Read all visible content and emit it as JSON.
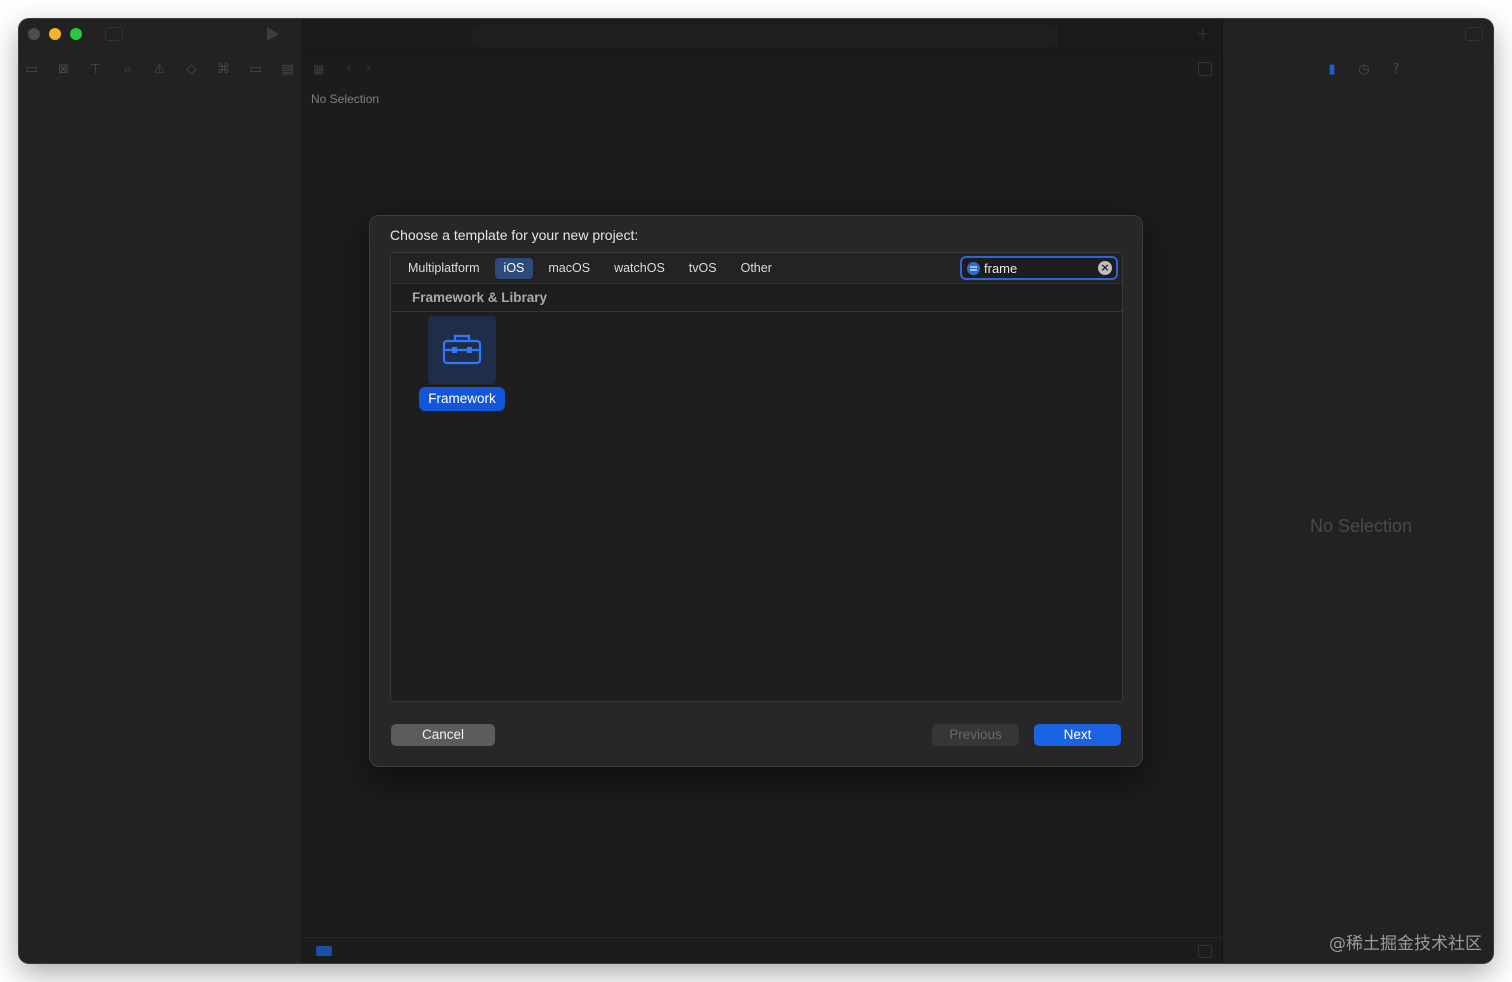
{
  "navigator": {
    "icons": [
      "folder-icon",
      "source-control-icon",
      "symbol-icon",
      "search-icon",
      "warning-icon",
      "test-diamond-icon",
      "debug-icon",
      "breakpoint-icon",
      "report-icon"
    ],
    "icon_glyphs": [
      "▭",
      "⊠",
      "⊤",
      "⌕",
      "⚠",
      "◇",
      "⌘",
      "▭",
      "▤"
    ]
  },
  "editor": {
    "no_selection": "No Selection"
  },
  "inspector": {
    "no_selection": "No Selection"
  },
  "dialog": {
    "title": "Choose a template for your new project:",
    "tabs": [
      {
        "label": "Multiplatform",
        "active": false
      },
      {
        "label": "iOS",
        "active": true
      },
      {
        "label": "macOS",
        "active": false
      },
      {
        "label": "watchOS",
        "active": false
      },
      {
        "label": "tvOS",
        "active": false
      },
      {
        "label": "Other",
        "active": false
      }
    ],
    "search": {
      "value": "frame"
    },
    "section_title": "Framework & Library",
    "template": {
      "label": "Framework",
      "icon": "toolbox-icon"
    },
    "buttons": {
      "cancel": "Cancel",
      "previous": "Previous",
      "next": "Next"
    }
  },
  "colors": {
    "accent": "#1c63e3",
    "selected_label": "#1356d8",
    "search_focus": "#2b66d9"
  },
  "watermark": "@稀土掘金技术社区"
}
